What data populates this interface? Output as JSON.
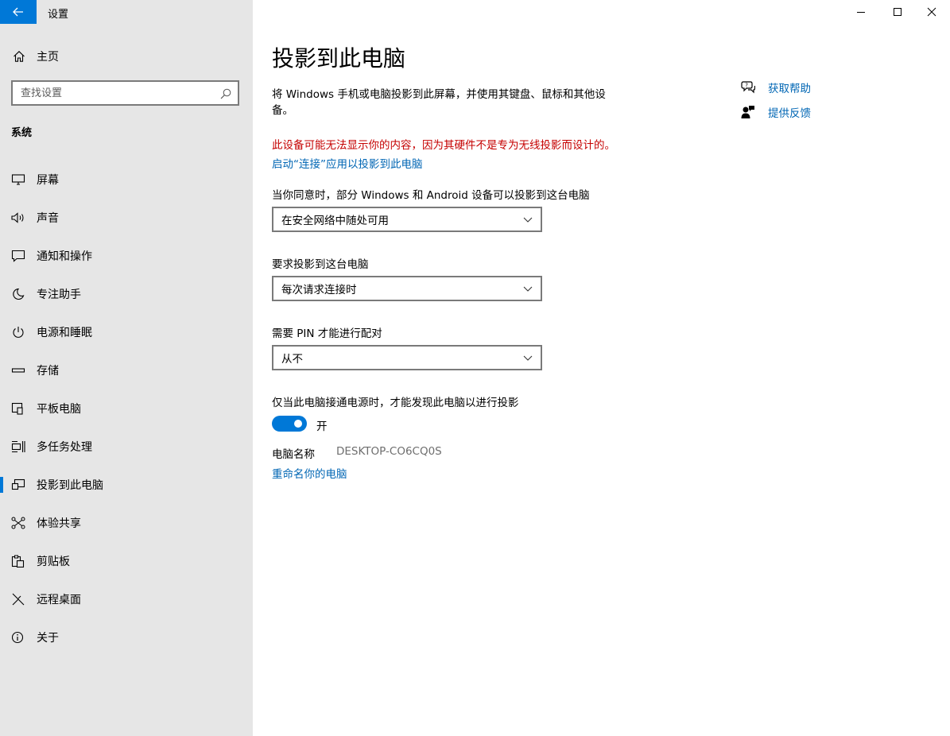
{
  "window": {
    "title": "设置"
  },
  "sidebar": {
    "home_label": "主页",
    "search_placeholder": "查找设置",
    "section_title": "系统",
    "items": [
      {
        "label": "屏幕",
        "icon": "monitor-icon"
      },
      {
        "label": "声音",
        "icon": "speaker-icon"
      },
      {
        "label": "通知和操作",
        "icon": "notification-icon"
      },
      {
        "label": "专注助手",
        "icon": "moon-icon"
      },
      {
        "label": "电源和睡眠",
        "icon": "power-icon"
      },
      {
        "label": "存储",
        "icon": "storage-icon"
      },
      {
        "label": "平板电脑",
        "icon": "tablet-icon"
      },
      {
        "label": "多任务处理",
        "icon": "multitask-icon"
      },
      {
        "label": "投影到此电脑",
        "icon": "project-icon",
        "selected": true
      },
      {
        "label": "体验共享",
        "icon": "share-icon"
      },
      {
        "label": "剪贴板",
        "icon": "clipboard-icon"
      },
      {
        "label": "远程桌面",
        "icon": "remote-desktop-icon"
      },
      {
        "label": "关于",
        "icon": "info-icon"
      }
    ]
  },
  "main": {
    "title": "投影到此电脑",
    "description": "将 Windows 手机或电脑投影到此屏幕，并使用其键盘、鼠标和其他设备。",
    "warning": "此设备可能无法显示你的内容，因为其硬件不是专为无线投影而设计的。",
    "connect_link": "启动“连接”应用以投影到此电脑",
    "availability": {
      "label": "当你同意时，部分 Windows 和 Android 设备可以投影到这台电脑",
      "value": "在安全网络中随处可用"
    },
    "ask_to_project": {
      "label": "要求投影到这台电脑",
      "value": "每次请求连接时"
    },
    "require_pin": {
      "label": "需要 PIN 才能进行配对",
      "value": "从不"
    },
    "power_only": {
      "label": "仅当此电脑接通电源时，才能发现此电脑以进行投影",
      "state": "开",
      "on": true
    },
    "pc_name_label": "电脑名称",
    "pc_name_value": "DESKTOP-CO6CQ0S",
    "rename_link": "重命名你的电脑"
  },
  "help": {
    "get_help": "获取帮助",
    "feedback": "提供反馈"
  },
  "colors": {
    "accent": "#0078d7",
    "link": "#0066b4",
    "warning": "#c50000",
    "sidebar_bg": "#e6e6e6"
  }
}
